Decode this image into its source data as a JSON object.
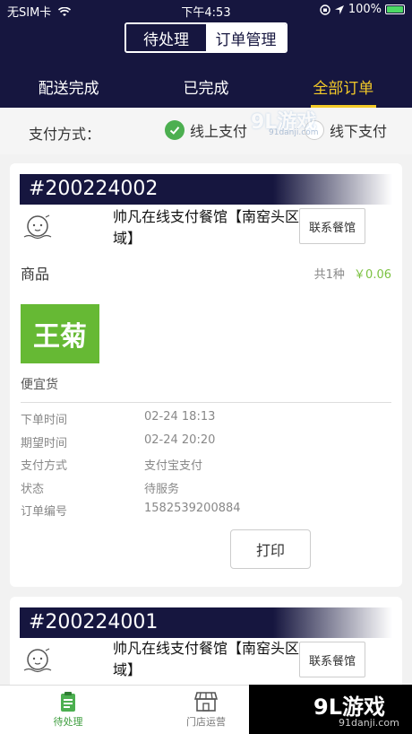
{
  "status_bar": {
    "carrier": "无SIM卡",
    "time": "下午4:53",
    "battery": "100%"
  },
  "segment": {
    "pending": "待处理",
    "manage": "订单管理"
  },
  "tabs": [
    "配送完成",
    "已完成",
    "全部订单"
  ],
  "payment_filter": {
    "label": "支付方式：",
    "online": "线上支付",
    "offline": "线下支付"
  },
  "orders": [
    {
      "number": "#200224002",
      "shop_name": "帅凡在线支付餐馆【南窑头区域】",
      "contact_label": "联系餐馆",
      "goods_label": "商品",
      "goods_count": "共1种",
      "goods_total": "￥0.06",
      "goods_image_text": "王菊",
      "goods_name": "便宜货",
      "details": [
        {
          "key": "下单时间",
          "value": "02-24 18:13"
        },
        {
          "key": "期望时间",
          "value": "02-24 20:20"
        },
        {
          "key": "支付方式",
          "value": "支付宝支付"
        },
        {
          "key": "状态",
          "value": "待服务"
        },
        {
          "key": "订单编号",
          "value": "1582539200884"
        }
      ],
      "print_label": "打印"
    },
    {
      "number": "#200224001",
      "shop_name": "帅凡在线支付餐馆【南窑头区域】",
      "contact_label": "联系餐馆"
    }
  ],
  "bottom_tabs": [
    {
      "label": "待处理",
      "icon": "clipboard-icon"
    },
    {
      "label": "门店运营",
      "icon": "store-icon"
    }
  ],
  "watermark": {
    "brand": "9L游戏",
    "url": "91danji.com"
  },
  "colors": {
    "navy": "#16163f",
    "accent_yellow": "#f3c928",
    "green": "#4caf50",
    "price_green": "#7cc242"
  }
}
